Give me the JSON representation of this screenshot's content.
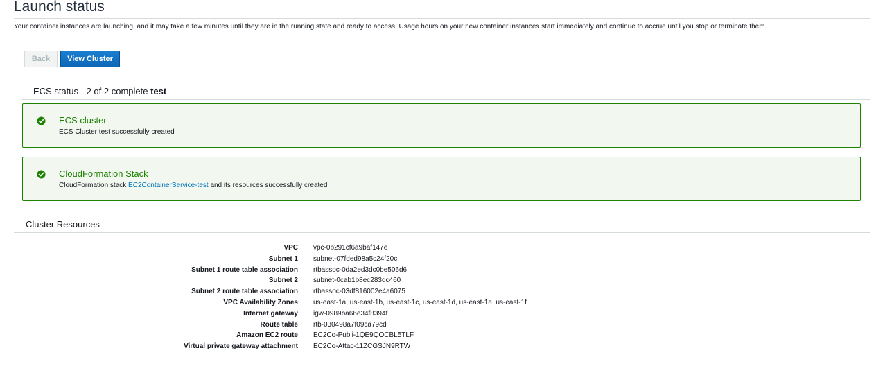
{
  "page": {
    "title": "Launch status",
    "intro": "Your container instances are launching, and it may take a few minutes until they are in the running state and ready to access. Usage hours on your new container instances start immediately and continue to accrue until you stop or terminate them."
  },
  "buttons": {
    "back": "Back",
    "view_cluster": "View Cluster"
  },
  "ecs_status": {
    "prefix": "ECS status - 2 of 2 complete",
    "name": "test"
  },
  "status_items": [
    {
      "title": "ECS cluster",
      "message": "ECS Cluster test successfully created",
      "icon": "check-circle-icon"
    },
    {
      "title": "CloudFormation Stack",
      "message_prefix": "CloudFormation stack",
      "link": "EC2ContainerService-test",
      "message_suffix": "and its resources successfully created",
      "icon": "check-circle-icon"
    }
  ],
  "cluster_resources": {
    "title": "Cluster Resources",
    "rows": [
      {
        "label": "VPC",
        "value": "vpc-0b291cf6a9baf147e",
        "link": true
      },
      {
        "label": "Subnet 1",
        "value": "subnet-07fded98a5c24f20c",
        "link": true
      },
      {
        "label": "Subnet 1 route table association",
        "value": "rtbassoc-0da2ed3dc0be506d6",
        "link": false
      },
      {
        "label": "Subnet 2",
        "value": "subnet-0cab1b8ec283dc460",
        "link": true
      },
      {
        "label": "Subnet 2 route table association",
        "value": "rtbassoc-03df816002e4a6075",
        "link": false
      },
      {
        "label": "VPC Availability Zones",
        "value": "us-east-1a, us-east-1b, us-east-1c, us-east-1d, us-east-1e, us-east-1f",
        "link": false
      },
      {
        "label": "Internet gateway",
        "value": "igw-0989ba66e34f8394f",
        "link": true
      },
      {
        "label": "Route table",
        "value": "rtb-030498a7f09ca79cd",
        "link": true
      },
      {
        "label": "Amazon EC2 route",
        "value": "EC2Co-Publi-1QE9QOCBL5TLF",
        "link": false
      },
      {
        "label": "Virtual private gateway attachment",
        "value": "EC2Co-Attac-11ZCGSJN9RTW",
        "link": false
      }
    ]
  },
  "colors": {
    "success": "#1d8102",
    "link": "#0073bb",
    "primary_button": "#0d67b8"
  }
}
